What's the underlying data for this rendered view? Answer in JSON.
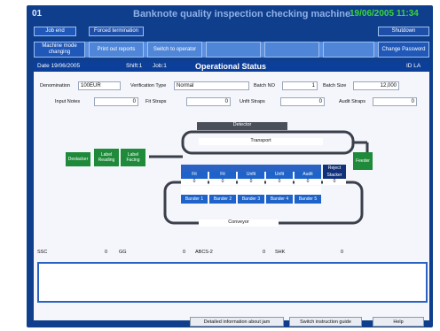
{
  "header": {
    "number": "01",
    "title": "Banknote quality inspection checking machine",
    "datetime": "19/06/2005 11:34"
  },
  "toolbar_row1": {
    "job_end": "Job end",
    "forced_termination": "Forced termination",
    "shutdown": "Shutdown"
  },
  "toolbar_row2": {
    "machine_mode_changing": "Machine mode changing",
    "print_out_reports": "Print out reports",
    "switch_to_operator": "Switch to operator",
    "change_password": "Change Password"
  },
  "status_bar": {
    "date": "Date 19/06/2005",
    "shift": "Shift:1",
    "job": "Job:1",
    "title": "Operational Status",
    "id": "ID LA"
  },
  "form_row1": {
    "denomination_label": "Denomination",
    "denomination_value": "100EUR",
    "verification_type_label": "Verification Type",
    "verification_type_value": "Normal",
    "batch_no_label": "Batch NO",
    "batch_no_value": "1",
    "batch_size_label": "Batch Size",
    "batch_size_value": "12,000"
  },
  "form_row2": {
    "input_notes_label": "Input Notes",
    "input_notes_value": "0",
    "fit_straps_label": "Fit Straps",
    "fit_straps_value": "0",
    "unfit_straps_label": "Unfit Straps",
    "unfit_straps_value": "0",
    "audit_straps_label": "Audit Straps",
    "audit_straps_value": "0"
  },
  "diagram": {
    "detector": "Detector",
    "transport": "Transport",
    "conveyor": "Conveyor",
    "feeder": "Feeder",
    "reject_stacker": "Reject Stacker",
    "reject_value": "0",
    "green_left": [
      "Destacker",
      "Label Reading",
      "Label Facing"
    ],
    "stackers": [
      {
        "label": "Fit",
        "value": "0",
        "bander": "Bander 1"
      },
      {
        "label": "Fit",
        "value": "0",
        "bander": "Bander 2"
      },
      {
        "label": "Unfit",
        "value": "0",
        "bander": "Bander 3"
      },
      {
        "label": "Unfit",
        "value": "0",
        "bander": "Bander 4"
      },
      {
        "label": "Audit",
        "value": "0",
        "bander": "Bander 5"
      }
    ]
  },
  "counters": [
    {
      "label": "SSC",
      "value": "0"
    },
    {
      "label": "GG",
      "value": "0"
    },
    {
      "label": "ABCS-2",
      "value": "0"
    },
    {
      "label": "SHK",
      "value": "0"
    }
  ],
  "bottom_buttons": {
    "details": "Detailed information about jam",
    "switch_guide": "Switch instruction guide",
    "help": "Help"
  }
}
